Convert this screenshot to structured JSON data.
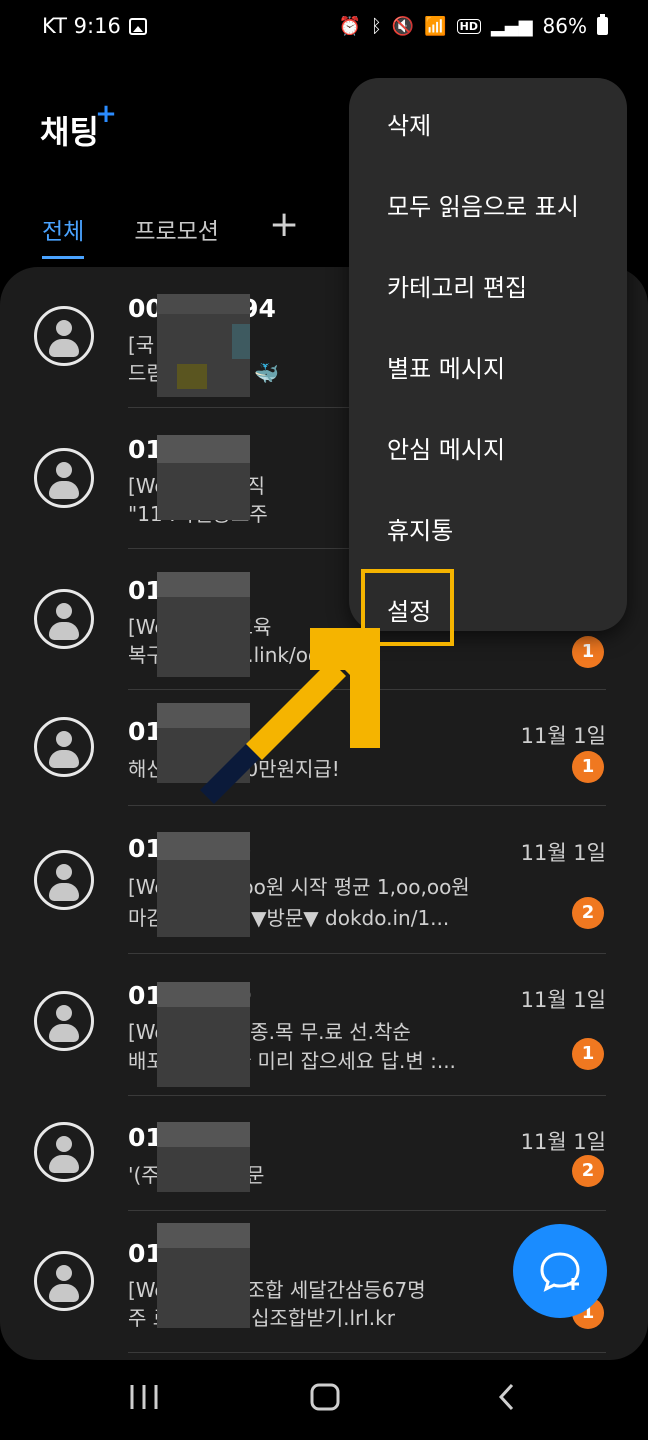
{
  "status_bar": {
    "carrier_time": "KT 9:16",
    "icons": [
      "gallery-icon",
      "alarm-icon",
      "bluetooth-icon",
      "mute-icon",
      "wifi-icon",
      "hd-icon",
      "signal-icon",
      "battery-icon"
    ],
    "hd_label": "HD",
    "battery": "86%"
  },
  "header": {
    "title": "채팅",
    "title_plus": "+",
    "tabs": [
      {
        "label": "전체",
        "active": true
      },
      {
        "label": "프로모션",
        "active": false
      }
    ],
    "add_tab_label": "+"
  },
  "conversations": [
    {
      "name": "00      467694",
      "line1": "[국      바다이야기",
      "line2": "드림      n.kro.kr 🐳",
      "date": "",
      "badge": ""
    },
    {
      "name": "01      -0767",
      "line1": "[We      바이오로직",
      "line2": "\"11      :특별공모주",
      "date": "",
      "badge": ""
    },
    {
      "name": "01      -3869",
      "line1": "[We      선 기초교육",
      "line2": "복구      백 swyg.link/od...",
      "date": "",
      "badge": "1"
    },
    {
      "name": "01      17",
      "line1": "해신      담무료 20만원지급!",
      "line2": "",
      "date": "11월 1일",
      "badge": "1"
    },
    {
      "name": "01      -2636",
      "line1": "[We      월 1o,ooo원 시작 평균 1,oo,oo원",
      "line2": "마감      성공비결 ▼방문▼ dokdo.in/1...",
      "date": "11월 1일",
      "badge": "2"
    },
    {
      "name": "01      -6430",
      "line1": "[We      .독입수\" 종.목 무.료 선.착순",
      "line2": "배포      나 옵니다 미리 잡으세요  답.변 :...",
      "date": "11월 1일",
      "badge": "1"
    },
    {
      "name": "01      -6635",
      "line1": "'(주      구인 공고문",
      "line2": "",
      "date": "11월 1일",
      "badge": "2"
    },
    {
      "name": "01      -6739",
      "line1": "[We      리미엄십조합 세달간삼등67명",
      "line2": "주      료 프리미엄십조합받기.lrl.kr",
      "date": "",
      "badge": "1"
    }
  ],
  "menu": {
    "items": [
      "삭제",
      "모두 읽음으로 표시",
      "카테고리 편집",
      "별표 메시지",
      "안심 메시지",
      "휴지통",
      "설정"
    ],
    "highlighted": "설정",
    "highlight_color": "#f5b400"
  },
  "fab": {
    "icon": "new-chat-icon",
    "color": "#1a8cff"
  },
  "nav": {
    "icons": [
      "recent-apps-icon",
      "home-icon",
      "back-icon"
    ]
  },
  "colors": {
    "accent": "#4aa3ff",
    "badge": "#f07820",
    "background": "#000000",
    "card": "#1c1c1c",
    "menu": "#2b2b2b"
  }
}
